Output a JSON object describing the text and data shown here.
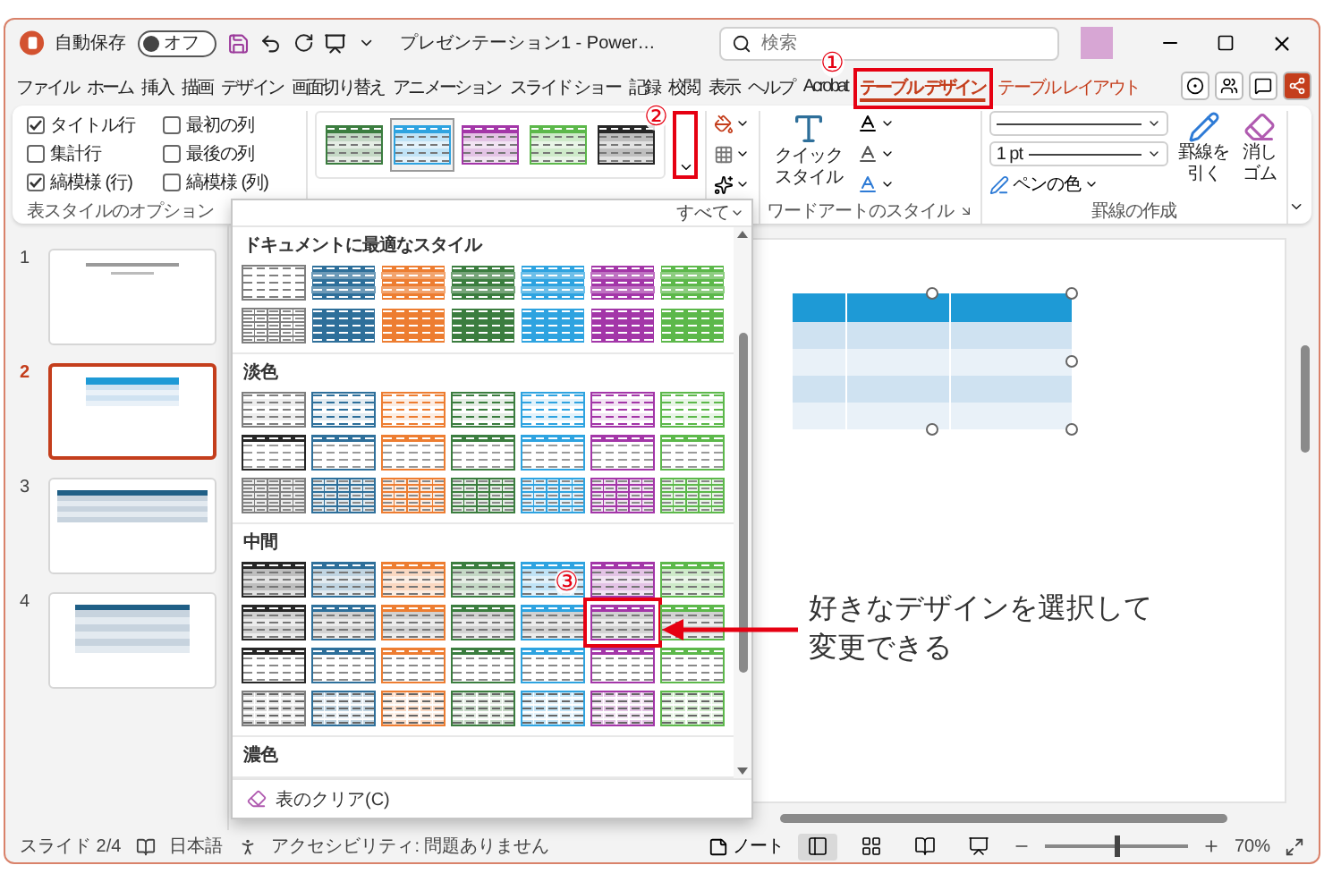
{
  "title_bar": {
    "autosave_label": "自動保存",
    "autosave_toggle": {
      "label": "オフ",
      "on": false
    },
    "document_title": "プレゼンテーション1 - Power…",
    "search": {
      "placeholder": "検索"
    }
  },
  "ribbon_tabs": [
    {
      "label": "ファイル",
      "selected": false,
      "contextual": false
    },
    {
      "label": "ホーム",
      "selected": false,
      "contextual": false
    },
    {
      "label": "挿入",
      "selected": false,
      "contextual": false
    },
    {
      "label": "描画",
      "selected": false,
      "contextual": false
    },
    {
      "label": "デザイン",
      "selected": false,
      "contextual": false
    },
    {
      "label": "画面切り替え",
      "selected": false,
      "contextual": false
    },
    {
      "label": "アニメーション",
      "selected": false,
      "contextual": false
    },
    {
      "label": "スライド ショー",
      "selected": false,
      "contextual": false
    },
    {
      "label": "記録",
      "selected": false,
      "contextual": false
    },
    {
      "label": "校閲",
      "selected": false,
      "contextual": false
    },
    {
      "label": "表示",
      "selected": false,
      "contextual": false
    },
    {
      "label": "ヘルプ",
      "selected": false,
      "contextual": false
    },
    {
      "label": "Acrobat",
      "selected": false,
      "contextual": false
    },
    {
      "label": "テーブル デザイン",
      "selected": true,
      "contextual": true,
      "callout": "①"
    },
    {
      "label": "テーブル レイアウト",
      "selected": false,
      "contextual": true
    }
  ],
  "table_style_options": {
    "title": "表スタイルのオプション",
    "options": [
      {
        "label": "タイトル行",
        "checked": true
      },
      {
        "label": "最初の列",
        "checked": false
      },
      {
        "label": "集計行",
        "checked": false
      },
      {
        "label": "最後の列",
        "checked": false
      },
      {
        "label": "縞模様 (行)",
        "checked": true
      },
      {
        "label": "縞模様 (列)",
        "checked": false
      }
    ]
  },
  "style_gallery": {
    "items": [
      {
        "color": "#3b7d3f",
        "selected": false
      },
      {
        "color": "#2ea3e0",
        "selected": true
      },
      {
        "color": "#a336a8",
        "selected": false
      },
      {
        "color": "#5cb84a",
        "selected": false
      },
      {
        "color": "#262626",
        "selected": false
      }
    ],
    "more_button": {
      "callout": "②"
    }
  },
  "wordart": {
    "title": "ワードアートのスタイル",
    "quick_styles_label": "クイックスタイル"
  },
  "borders": {
    "title": "罫線の作成",
    "pen_weight": "1 pt",
    "pen_color_label": "ペンの色",
    "draw_table_label": "罫線を引く",
    "eraser_label": "消しゴム"
  },
  "slides": [
    {
      "number": "1",
      "selected": false,
      "kind": "title"
    },
    {
      "number": "2",
      "selected": true,
      "kind": "table_light"
    },
    {
      "number": "3",
      "selected": false,
      "kind": "table_wide"
    },
    {
      "number": "4",
      "selected": false,
      "kind": "table_dark"
    }
  ],
  "gallery_dropdown": {
    "filter": "すべて",
    "clear_label": "表のクリア(C)",
    "sections": [
      {
        "title": "ドキュメントに最適なスタイル",
        "rows": [
          [
            {
              "kind": "plain",
              "color": "#7f7f7f"
            },
            {
              "kind": "band-dark",
              "color": "#2e6f9a"
            },
            {
              "kind": "band-dark",
              "color": "#ed7d31"
            },
            {
              "kind": "band-dark",
              "color": "#3b7d3f"
            },
            {
              "kind": "band-dark",
              "color": "#2ea3e0"
            },
            {
              "kind": "band-dark",
              "color": "#a336a8"
            },
            {
              "kind": "band-dark",
              "color": "#5cb84a"
            }
          ],
          [
            {
              "kind": "grid",
              "color": "#7f7f7f"
            },
            {
              "kind": "solid",
              "color": "#2e6f9a"
            },
            {
              "kind": "solid",
              "color": "#ed7d31"
            },
            {
              "kind": "solid",
              "color": "#3b7d3f"
            },
            {
              "kind": "solid",
              "color": "#2ea3e0"
            },
            {
              "kind": "solid",
              "color": "#a336a8"
            },
            {
              "kind": "solid",
              "color": "#5cb84a"
            }
          ]
        ]
      },
      {
        "title": "淡色",
        "rows": [
          [
            {
              "kind": "light-band",
              "color": "#7f7f7f"
            },
            {
              "kind": "light-band",
              "color": "#2e6f9a"
            },
            {
              "kind": "light-band",
              "color": "#ed7d31"
            },
            {
              "kind": "light-band",
              "color": "#3b7d3f"
            },
            {
              "kind": "light-band",
              "color": "#2ea3e0"
            },
            {
              "kind": "light-band",
              "color": "#a336a8"
            },
            {
              "kind": "light-band",
              "color": "#5cb84a"
            }
          ],
          [
            {
              "kind": "light-head",
              "color": "#262626"
            },
            {
              "kind": "light-head",
              "color": "#2e6f9a"
            },
            {
              "kind": "light-head",
              "color": "#ed7d31"
            },
            {
              "kind": "light-head",
              "color": "#3b7d3f"
            },
            {
              "kind": "light-head",
              "color": "#2ea3e0"
            },
            {
              "kind": "light-head",
              "color": "#a336a8"
            },
            {
              "kind": "light-head",
              "color": "#5cb84a"
            }
          ],
          [
            {
              "kind": "light-grid",
              "color": "#7f7f7f"
            },
            {
              "kind": "light-grid",
              "color": "#2e6f9a"
            },
            {
              "kind": "light-grid",
              "color": "#ed7d31"
            },
            {
              "kind": "light-grid",
              "color": "#3b7d3f"
            },
            {
              "kind": "light-grid",
              "color": "#2ea3e0"
            },
            {
              "kind": "light-grid",
              "color": "#a336a8"
            },
            {
              "kind": "light-grid",
              "color": "#5cb84a"
            }
          ]
        ]
      },
      {
        "title": "中間",
        "rows": [
          [
            {
              "kind": "med-band",
              "color": "#262626"
            },
            {
              "kind": "med-band",
              "color": "#2e6f9a"
            },
            {
              "kind": "med-band",
              "color": "#ed7d31"
            },
            {
              "kind": "med-band",
              "color": "#3b7d3f"
            },
            {
              "kind": "med-band",
              "color": "#2ea3e0"
            },
            {
              "kind": "med-band",
              "color": "#a336a8"
            },
            {
              "kind": "med-band",
              "color": "#5cb84a"
            }
          ],
          [
            {
              "kind": "med-head",
              "color": "#262626"
            },
            {
              "kind": "med-head",
              "color": "#2e6f9a"
            },
            {
              "kind": "med-head",
              "color": "#ed7d31"
            },
            {
              "kind": "med-head",
              "color": "#3b7d3f"
            },
            {
              "kind": "med-head",
              "color": "#2ea3e0"
            },
            {
              "kind": "med-head",
              "color": "#a336a8",
              "callout": "③"
            },
            {
              "kind": "med-head",
              "color": "#5cb84a"
            }
          ],
          [
            {
              "kind": "med-top",
              "color": "#262626"
            },
            {
              "kind": "med-top",
              "color": "#2e6f9a"
            },
            {
              "kind": "med-top",
              "color": "#ed7d31"
            },
            {
              "kind": "med-top",
              "color": "#3b7d3f"
            },
            {
              "kind": "med-top",
              "color": "#2ea3e0"
            },
            {
              "kind": "med-top",
              "color": "#a336a8"
            },
            {
              "kind": "med-top",
              "color": "#5cb84a"
            }
          ],
          [
            {
              "kind": "med-grid",
              "color": "#7f7f7f"
            },
            {
              "kind": "med-grid",
              "color": "#2e6f9a"
            },
            {
              "kind": "med-grid",
              "color": "#ed7d31"
            },
            {
              "kind": "med-grid",
              "color": "#3b7d3f"
            },
            {
              "kind": "med-grid",
              "color": "#2ea3e0"
            },
            {
              "kind": "med-grid",
              "color": "#a336a8"
            },
            {
              "kind": "med-grid",
              "color": "#5cb84a"
            }
          ]
        ]
      },
      {
        "title": "濃色"
      }
    ]
  },
  "annotation": {
    "lines": [
      "好きなデザインを選択して",
      "変更できる"
    ]
  },
  "status_bar": {
    "slide_indicator": "スライド 2/4",
    "language": "日本語",
    "accessibility": "アクセシビリティ: 問題ありません",
    "notes_label": "ノート",
    "views": [
      {
        "kind": "normal",
        "selected": true
      },
      {
        "kind": "sorter",
        "selected": false
      },
      {
        "kind": "reading",
        "selected": false
      },
      {
        "kind": "slideshow",
        "selected": false
      }
    ],
    "zoom_slider": {
      "level": 0.5
    },
    "zoom": "70%"
  }
}
